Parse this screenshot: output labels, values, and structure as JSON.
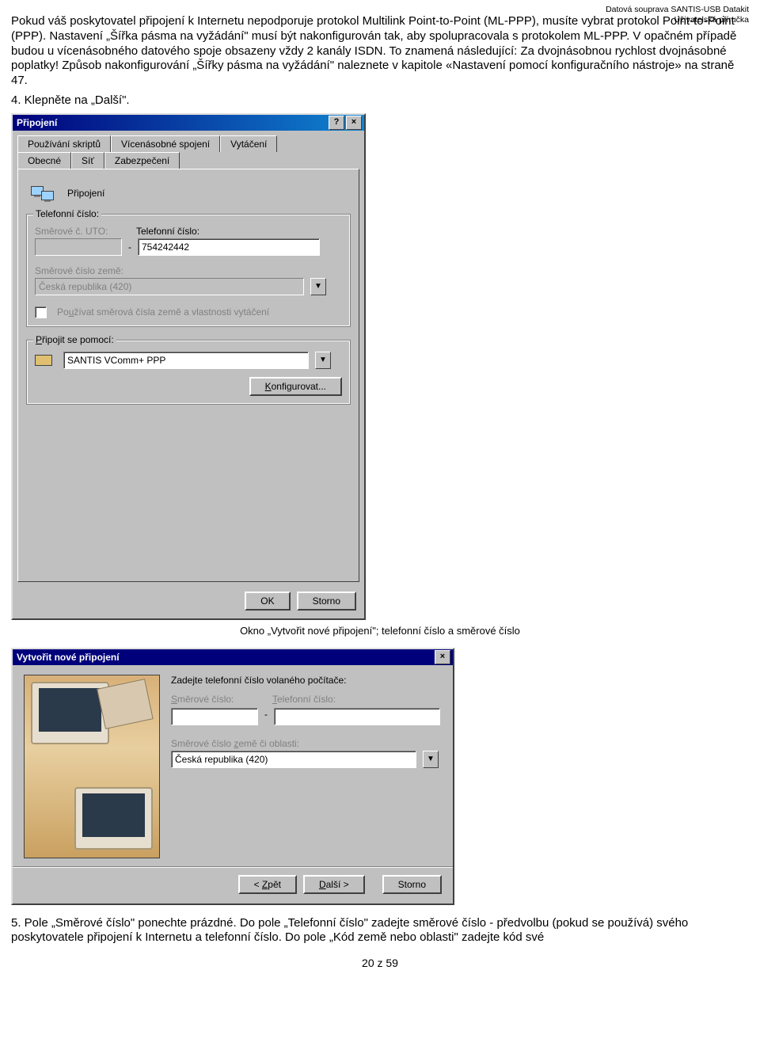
{
  "header": {
    "line1": "Datová souprava SANTIS-USB Datakit",
    "line2": "Uživatelská příručka"
  },
  "paragraph1": "Pokud váš poskytovatel připojení k Internetu nepodporuje protokol Multilink Point-to-Point (ML-PPP), musíte vybrat protokol Point-to-Point (PPP). Nastavení „Šířka pásma na vyžádání\" musí být nakonfigurován tak, aby spolupracovala s protokolem ML-PPP. V opačném případě budou u vícenásobného datového spoje obsazeny vždy 2 kanály ISDN. To znamená následující: Za dvojnásobnou rychlost dvojnásobné poplatky! Způsob nakonfigurování „Šířky pásma na vyžádání\" naleznete v kapitole «Nastavení pomocí konfiguračního nástroje» na straně 47.",
  "step4": "4.  Klepněte na „Další\".",
  "dialog1": {
    "title": "Připojení",
    "tabs_back": [
      "Používání skriptů",
      "Vícenásobné spojení",
      "Vytáčení"
    ],
    "tabs_front": [
      "Obecné",
      "Síť",
      "Zabezpečení"
    ],
    "section_label": "Připojení",
    "group_phone": {
      "legend": "Telefonní číslo:",
      "area_label": "Směrové č. UTO:",
      "phone_label": "Telefonní číslo:",
      "area_value": "",
      "dash": "-",
      "phone_value": "754242442",
      "country_label": "Směrové číslo země:",
      "country_value": "Česká republika (420)",
      "use_codes_label": "Používat směrová čísla země a vlastnosti vytáčení"
    },
    "group_connect": {
      "legend": "Připojit se pomocí:",
      "device_value": "SANTIS VComm+ PPP",
      "configure_btn": "Konfigurovat..."
    },
    "ok_btn": "OK",
    "cancel_btn": "Storno"
  },
  "caption1": "Okno „Vytvořit nové připojení\"; telefonní číslo a směrové číslo",
  "dialog2": {
    "title": "Vytvořit nové připojení",
    "prompt": "Zadejte telefonní číslo volaného počítače:",
    "area_label": "Směrové číslo:",
    "phone_label": "Telefonní číslo:",
    "area_value": "",
    "dash": "-",
    "phone_value": "",
    "country_label": "Směrové číslo země či oblasti:",
    "country_value": "Česká republika (420)",
    "back_btn": "< Zpět",
    "next_btn": "Další >",
    "cancel_btn": "Storno"
  },
  "paragraph2": "5.  Pole „Směrové číslo\" ponechte prázdné. Do pole „Telefonní číslo\" zadejte směrové číslo - předvolbu (pokud se používá) svého poskytovatele připojení k Internetu a telefonní číslo. Do pole „Kód země nebo oblasti\" zadejte kód své",
  "page_num": "20 z 59"
}
